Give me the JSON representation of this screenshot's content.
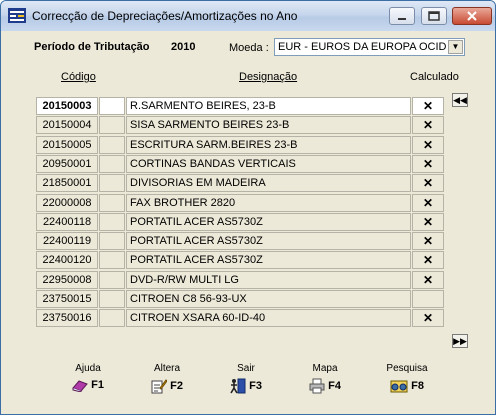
{
  "window": {
    "title": "Correcção de Depreciações/Amortizações no Ano"
  },
  "header": {
    "period_label": "Período de Tributação",
    "period_year": "2010",
    "currency_label": "Moeda :",
    "currency_value": "EUR - EUROS DA EUROPA OCID"
  },
  "columns": {
    "code": "Código",
    "designation": "Designação",
    "calculated": "Calculado"
  },
  "rows": [
    {
      "code": "20150003",
      "desc": "R.SARMENTO BEIRES, 23-B",
      "calc": "✕",
      "selected": true
    },
    {
      "code": "20150004",
      "desc": "SISA SARMENTO BEIRES 23-B",
      "calc": "✕"
    },
    {
      "code": "20150005",
      "desc": "ESCRITURA SARM.BEIRES 23-B",
      "calc": "✕"
    },
    {
      "code": "20950001",
      "desc": "CORTINAS BANDAS VERTICAIS",
      "calc": "✕"
    },
    {
      "code": "21850001",
      "desc": "DIVISORIAS EM MADEIRA",
      "calc": "✕"
    },
    {
      "code": "22000008",
      "desc": "FAX BROTHER 2820",
      "calc": "✕"
    },
    {
      "code": "22400118",
      "desc": "PORTATIL ACER AS5730Z",
      "calc": "✕"
    },
    {
      "code": "22400119",
      "desc": "PORTATIL ACER AS5730Z",
      "calc": "✕"
    },
    {
      "code": "22400120",
      "desc": "PORTATIL ACER AS5730Z",
      "calc": "✕"
    },
    {
      "code": "22950008",
      "desc": "DVD-R/RW MULTI LG",
      "calc": "✕"
    },
    {
      "code": "23750015",
      "desc": "CITROEN C8 56-93-UX",
      "calc": ""
    },
    {
      "code": "23750016",
      "desc": "CITROEN XSARA 60-ID-40",
      "calc": "✕"
    }
  ],
  "function_keys": [
    {
      "label": "Ajuda",
      "key": "F1",
      "icon": "help-book-icon"
    },
    {
      "label": "Altera",
      "key": "F2",
      "icon": "edit-pencil-icon"
    },
    {
      "label": "Sair",
      "key": "F3",
      "icon": "exit-door-icon"
    },
    {
      "label": "Mapa",
      "key": "F4",
      "icon": "printer-icon"
    },
    {
      "label": "Pesquisa",
      "key": "F8",
      "icon": "search-binoculars-icon"
    }
  ],
  "colors": {
    "window_bg": "#ece9d8",
    "title_gradient_top": "#dfe8f6",
    "close_button": "#c84a32",
    "selected_row_bg": "#ffffff"
  }
}
